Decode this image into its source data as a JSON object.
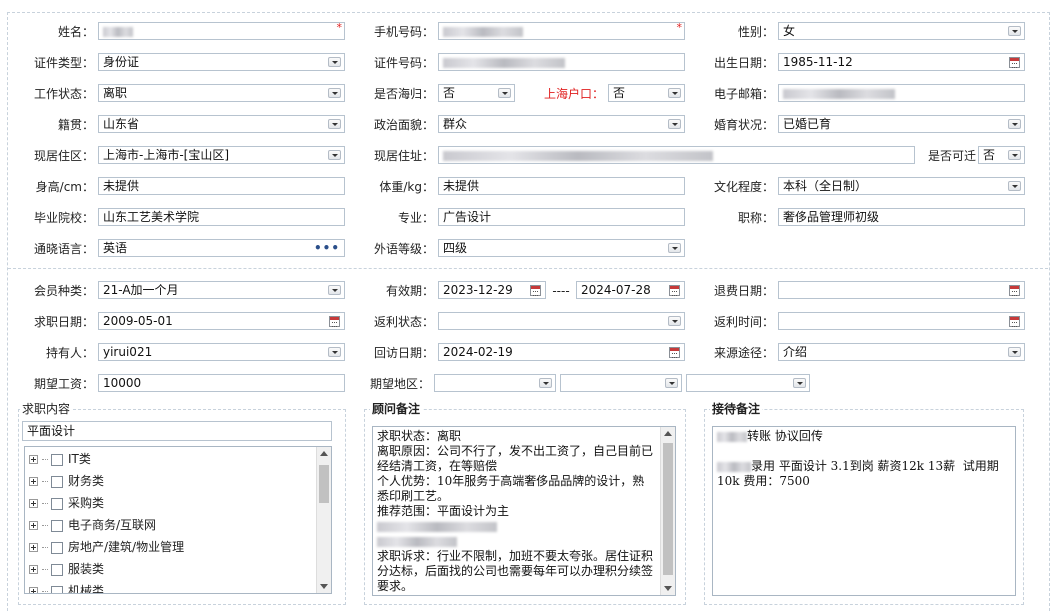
{
  "row1": {
    "name_label": "姓名：",
    "phone_label": "手机号码：",
    "gender_label": "性别：",
    "gender_value": "女",
    "required_mark": "*"
  },
  "row2": {
    "idtype_label": "证件类型：",
    "idtype_value": "身份证",
    "idno_label": "证件号码：",
    "birth_label": "出生日期：",
    "birth_value": "1985-11-12"
  },
  "row3": {
    "workstatus_label": "工作状态：",
    "workstatus_value": "离职",
    "returnee_label": "是否海归：",
    "returnee_value": "否",
    "hukou_label": "上海户口：",
    "hukou_value": "否",
    "email_label": "电子邮箱："
  },
  "row4": {
    "origin_label": "籍贯：",
    "origin_value": "山东省",
    "political_label": "政治面貌：",
    "political_value": "群众",
    "marital_label": "婚育状况：",
    "marital_value": "已婚已育"
  },
  "row5": {
    "residence_label": "现居住区：",
    "residence_value": "上海市-上海市-[宝山区]",
    "address_label": "现居住址：",
    "relocate_label": "是否可迁",
    "relocate_value": "否"
  },
  "row6": {
    "height_label": "身高/cm：",
    "height_value": "未提供",
    "weight_label": "体重/kg：",
    "weight_value": "未提供",
    "education_label": "文化程度：",
    "education_value": "本科（全日制）"
  },
  "row7": {
    "school_label": "毕业院校：",
    "school_value": "山东工艺美术学院",
    "major_label": "专业：",
    "major_value": "广告设计",
    "title_label": "职称：",
    "title_value": "奢侈品管理师初级"
  },
  "row8": {
    "language_label": "通晓语言：",
    "language_value": "英语",
    "language_more": "•••",
    "foreign_level_label": "外语等级：",
    "foreign_level_value": "四级"
  },
  "row9": {
    "member_label": "会员种类：",
    "member_value": "21-A加一个月",
    "valid_label": "有效期：",
    "valid_from": "2023-12-29",
    "valid_sep": "----",
    "valid_to": "2024-07-28",
    "refund_date_label": "退费日期："
  },
  "row10": {
    "jobdate_label": "求职日期：",
    "jobdate_value": "2009-05-01",
    "rebate_status_label": "返利状态：",
    "rebate_status_value": "",
    "rebate_time_label": "返利时间：",
    "rebate_time_value": ""
  },
  "row11": {
    "holder_label": "持有人：",
    "holder_value": "yirui021",
    "revisit_label": "回访日期：",
    "revisit_value": "2024-02-19",
    "source_label": "来源途径：",
    "source_value": "介绍"
  },
  "row12": {
    "salary_label": "期望工资：",
    "salary_value": "10000",
    "region_label": "期望地区："
  },
  "job_panel": {
    "title": "求职内容",
    "selected": "平面设计",
    "items": [
      "IT类",
      "财务类",
      "采购类",
      "电子商务/互联网",
      "房地产/建筑/物业管理",
      "服装类",
      "机械类"
    ]
  },
  "advisor_panel": {
    "title": "顾问备注",
    "l1": "求职状态：离职",
    "l2": "离职原因：公司不行了，发不出工资了，自己目前已经结清工资，在等赔偿",
    "l3": "个人优势：10年服务于高端奢侈品品牌的设计，熟悉印刷工艺。",
    "l4": "推荐范围：平面设计为主",
    "l5": "求职诉求：行业不限制，加班不要太夸张。居住证积分达标，后面找的公司也需要每年可以办理积分续签要求。"
  },
  "reception_panel": {
    "title": "接待备注",
    "l1": "转账 协议回传",
    "l2": "录用 平面设计 3.1到岗 薪资12k 13薪  试用期10k 费用：7500"
  },
  "colors": {
    "border": "#b7c3cf",
    "dashed": "#c8d2dc",
    "required": "#e02020"
  },
  "icons": [
    "dropdown-arrow-icon",
    "calendar-icon",
    "more-dots-icon",
    "tree-expand-icon",
    "checkbox-icon"
  ]
}
